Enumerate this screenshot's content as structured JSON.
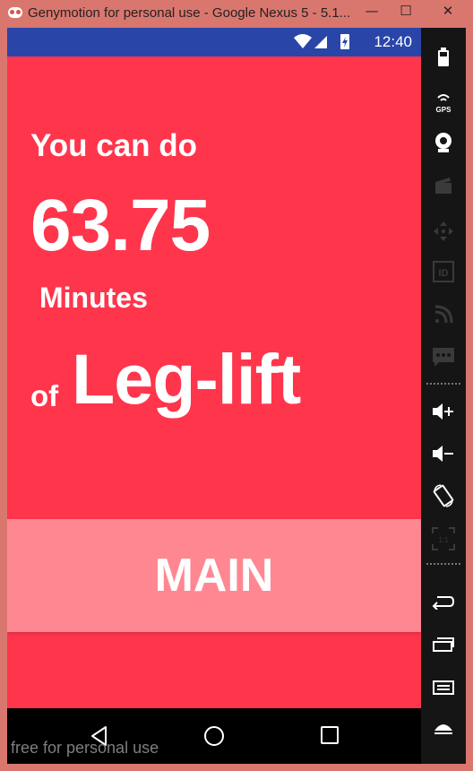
{
  "window": {
    "title": "Genymotion for personal use - Google Nexus 5 - 5.1...",
    "minimize": "—",
    "maximize": "☐",
    "close": "✕"
  },
  "status_bar": {
    "time": "12:40"
  },
  "content": {
    "line1": "You can do",
    "number": "63.75",
    "unit": "Minutes",
    "of": "of",
    "exercise": "Leg-lift"
  },
  "main_button": {
    "label": "MAIN"
  },
  "watermark": "free for personal use",
  "side_panel": {
    "gps_label": "GPS",
    "items": [
      "battery-icon",
      "gps-icon",
      "webcam-icon",
      "clapperboard-icon",
      "dpad-icon",
      "id-icon",
      "rss-icon",
      "sms-icon",
      "volume-up-icon",
      "volume-down-icon",
      "rotate-icon",
      "pixel-perfect-icon",
      "back-icon",
      "recent-apps-icon",
      "menu-icon",
      "home-icon"
    ]
  },
  "colors": {
    "background": "#ff354c",
    "button": "#ff8791",
    "status_bar": "#2945a8",
    "window_frame": "#d9776f"
  }
}
